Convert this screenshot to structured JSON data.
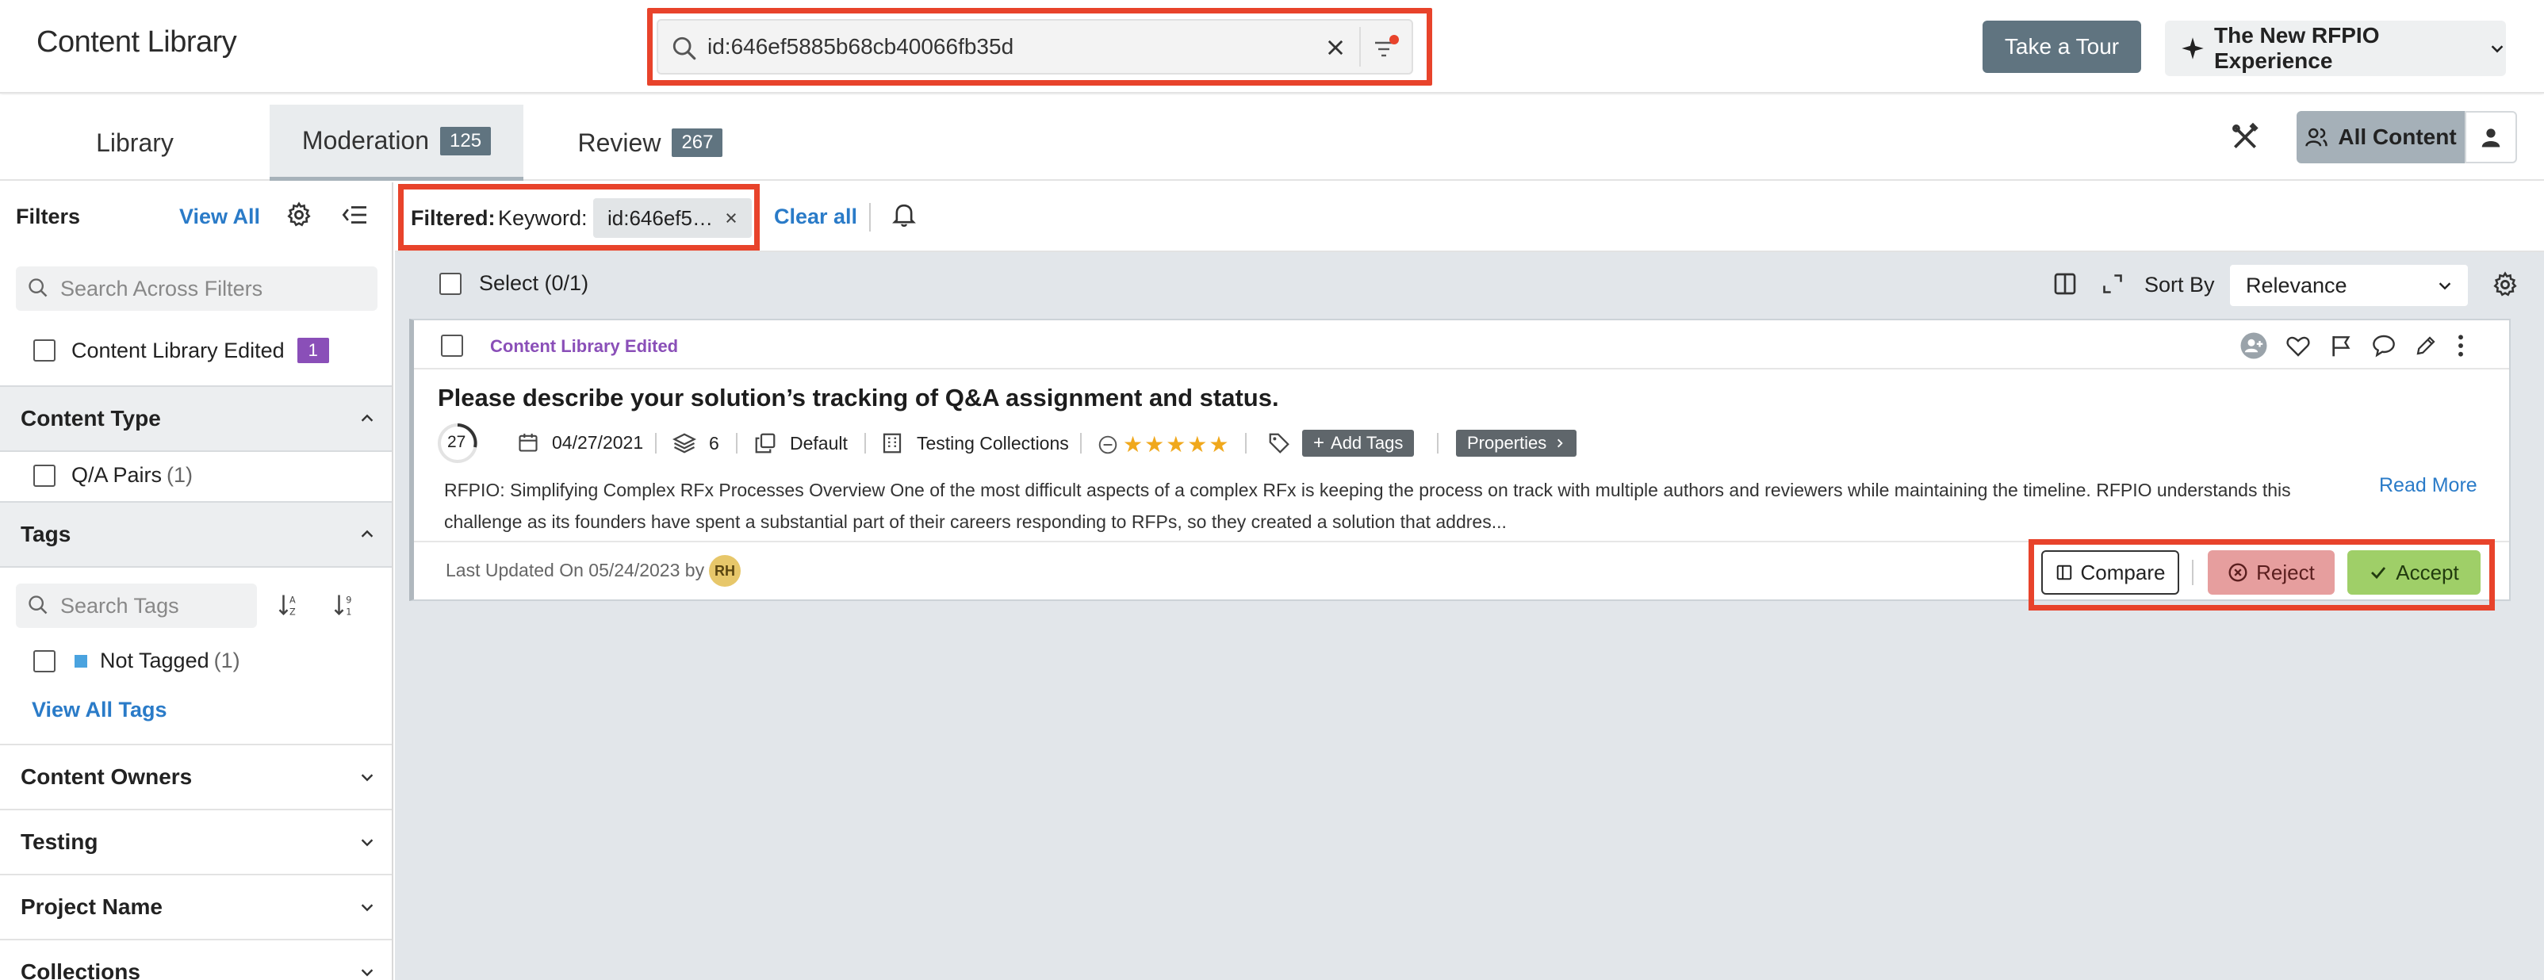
{
  "header": {
    "title": "Content Library",
    "search_value": "id:646ef5885b68cb40066fb35d",
    "tour_label": "Take a Tour",
    "experience_label": "The New RFPIO Experience"
  },
  "tabs": [
    {
      "label": "Library"
    },
    {
      "label": "Moderation",
      "count": "125"
    },
    {
      "label": "Review",
      "count": "267"
    }
  ],
  "view_toggle": {
    "all_content_label": "All Content"
  },
  "sidebar": {
    "filters_label": "Filters",
    "view_all_label": "View All",
    "search_filters_placeholder": "Search Across Filters",
    "content_library_edited": {
      "label": "Content Library Edited",
      "count": "1"
    },
    "content_type": {
      "title": "Content Type",
      "option_label": "Q/A Pairs",
      "option_count": "(1)"
    },
    "tags": {
      "title": "Tags",
      "search_placeholder": "Search Tags",
      "not_tagged_label": "Not Tagged",
      "not_tagged_count": "(1)",
      "view_all_label": "View All Tags"
    },
    "collapsed_sections": [
      "Content Owners",
      "Testing",
      "Project Name",
      "Collections"
    ]
  },
  "filter_bar": {
    "filtered_label": "Filtered:",
    "keyword_label": "Keyword:",
    "keyword_chip": "id:646ef5…",
    "clear_all_label": "Clear all"
  },
  "toolbar": {
    "select_label": "Select (0/1)",
    "sort_by_label": "Sort By",
    "sort_value": "Relevance"
  },
  "card": {
    "tag_label": "Content Library Edited",
    "title": "Please describe your solution’s tracking of Q&A assignment and status.",
    "score": "27",
    "date": "04/27/2021",
    "versions": "6",
    "library": "Default",
    "collection": "Testing Collections",
    "add_tags_label": "Add Tags",
    "properties_label": "Properties",
    "description": "RFPIO: Simplifying Complex RFx Processes Overview One of the most difficult aspects of a complex RFx is keeping the process on track with multiple authors and reviewers while maintaining the timeline. RFPIO understands this challenge as its founders have spent a substantial part of their careers responding to RFPs, so they created a solution that addres...",
    "read_more_label": "Read More",
    "last_updated": "Last Updated On 05/24/2023 by",
    "avatar_initials": "RH",
    "compare_label": "Compare",
    "reject_label": "Reject",
    "accept_label": "Accept",
    "star_rating": 5
  },
  "colors": {
    "highlight": "#e8432b",
    "accent_link": "#2a7bc8",
    "badge_purple": "#8a4fb8",
    "accept": "#9fcf68",
    "reject": "#e69e9e"
  }
}
